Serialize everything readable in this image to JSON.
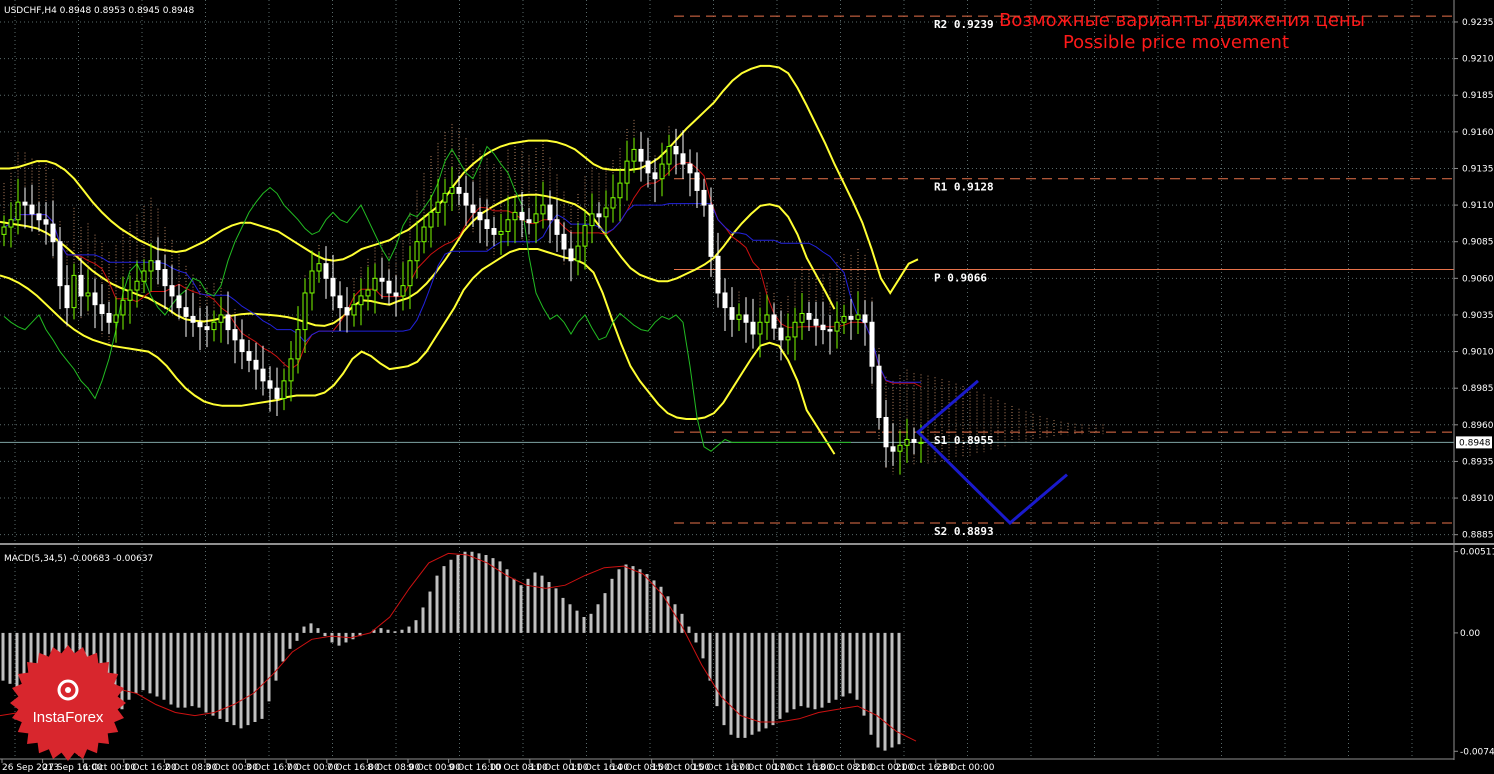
{
  "header": {
    "main": "USDCHF,H4  0.8948 0.8953 0.8945 0.8948",
    "macd": "MACD(5,34,5) -0.00683 -0.00637"
  },
  "title": {
    "line1": "Возможные варианты движения цены",
    "line2": "Possible price movement",
    "color": "#ff1a1a"
  },
  "levels": [
    {
      "name": "R2",
      "label": "R2  0.9239",
      "value": 0.9239,
      "color": "#e8724a",
      "style": "dashed"
    },
    {
      "name": "R1",
      "label": "R1  0.9128",
      "value": 0.9128,
      "color": "#e8724a",
      "style": "dashed"
    },
    {
      "name": "P",
      "label": "P  0.9066",
      "value": 0.9066,
      "color": "#e8724a",
      "style": "solid"
    },
    {
      "name": "S1",
      "label": "S1  0.8955",
      "value": 0.8955,
      "color": "#e8724a",
      "style": "dashed"
    },
    {
      "name": "S2",
      "label": "S2  0.8893",
      "value": 0.8893,
      "color": "#e8724a",
      "style": "dashed"
    }
  ],
  "current_price": {
    "label": "0.8948",
    "value": 0.8948
  },
  "price_axis": {
    "ticks": [
      "0.9235",
      "0.9210",
      "0.9185",
      "0.9160",
      "0.9135",
      "0.9110",
      "0.9085",
      "0.9060",
      "0.9035",
      "0.9010",
      "0.8985",
      "0.8960",
      "0.8935",
      "0.8910",
      "0.8885"
    ],
    "min": 0.888,
    "max": 0.925
  },
  "macd_axis": {
    "ticks": [
      "0.00511",
      "0.00",
      "-0.00744"
    ],
    "min": -0.0078,
    "max": 0.0054
  },
  "time_axis": {
    "labels": [
      "26 Sep 2013",
      "27 Sep 16:00",
      "1 Oct 00:00",
      "1 Oct 16:00",
      "2 Oct 08:00",
      "3 Oct 00:00",
      "3 Oct 16:00",
      "7 Oct 00:00",
      "7 Oct 16:00",
      "8 Oct 08:00",
      "9 Oct 00:00",
      "9 Oct 16:00",
      "10 Oct 08:00",
      "11 Oct 00:00",
      "11 Oct 16:00",
      "14 Oct 08:00",
      "15 Oct 00:00",
      "15 Oct 16:00",
      "17 Oct 00:00",
      "17 Oct 16:00",
      "18 Oct 08:00",
      "21 Oct 00:00",
      "21 Oct 16:00",
      "23 Oct 00:00"
    ]
  },
  "colors": {
    "bull_candle": "#7cfc00",
    "bear_candle": "#ffffff",
    "bollinger": "#ffff33",
    "kijun": "#cc1111",
    "tenkun": "#2222dd",
    "chikou": "#22bb22",
    "cloud": "#d69a70",
    "forecast": "#1a1acc",
    "macd_hist": "#c0c0c0",
    "macd_signal": "#cc1111",
    "grid": "#5a6a6a"
  },
  "logo": {
    "text": "InstaForex",
    "color": "#d8262d"
  },
  "chart_data": {
    "type": "candlestick",
    "symbol": "USDCHF",
    "timeframe": "H4",
    "ylim": [
      0.888,
      0.925
    ],
    "closes": [
      0.9095,
      0.91,
      0.9112,
      0.911,
      0.9104,
      0.91,
      0.9097,
      0.9085,
      0.9055,
      0.904,
      0.9062,
      0.9048,
      0.905,
      0.9042,
      0.9036,
      0.903,
      0.9035,
      0.9045,
      0.9052,
      0.9058,
      0.9065,
      0.9072,
      0.9066,
      0.9055,
      0.9048,
      0.904,
      0.9034,
      0.903,
      0.9027,
      0.9025,
      0.903,
      0.9035,
      0.9025,
      0.9018,
      0.901,
      0.9004,
      0.8998,
      0.899,
      0.8985,
      0.8978,
      0.899,
      0.9005,
      0.9025,
      0.905,
      0.9065,
      0.907,
      0.906,
      0.9048,
      0.904,
      0.9035,
      0.9042,
      0.9048,
      0.9052,
      0.906,
      0.9058,
      0.905,
      0.9048,
      0.9055,
      0.9072,
      0.9085,
      0.9095,
      0.9105,
      0.9112,
      0.9118,
      0.9122,
      0.9118,
      0.911,
      0.9105,
      0.91,
      0.9094,
      0.909,
      0.9092,
      0.91,
      0.9105,
      0.91,
      0.9098,
      0.9104,
      0.911,
      0.91,
      0.909,
      0.908,
      0.9072,
      0.9082,
      0.9096,
      0.9104,
      0.9102,
      0.9108,
      0.9115,
      0.9125,
      0.914,
      0.9148,
      0.914,
      0.9132,
      0.9128,
      0.9138,
      0.915,
      0.9145,
      0.9138,
      0.9132,
      0.912,
      0.911,
      0.9075,
      0.905,
      0.904,
      0.9032,
      0.9035,
      0.903,
      0.9022,
      0.903,
      0.9035,
      0.9026,
      0.9018,
      0.902,
      0.903,
      0.9036,
      0.9032,
      0.9028,
      0.9025,
      0.9024,
      0.903,
      0.9034,
      0.9032,
      0.9035,
      0.903,
      0.9,
      0.8965,
      0.8945,
      0.8942,
      0.8946,
      0.895,
      0.8948,
      0.8948
    ],
    "opens": [
      0.909,
      0.9095,
      0.91,
      0.9112,
      0.911,
      0.9104,
      0.91,
      0.9097,
      0.9085,
      0.9055,
      0.904,
      0.9062,
      0.9048,
      0.905,
      0.9042,
      0.9036,
      0.903,
      0.9035,
      0.9045,
      0.9052,
      0.9058,
      0.9065,
      0.9072,
      0.9066,
      0.9055,
      0.9048,
      0.904,
      0.9034,
      0.903,
      0.9027,
      0.9025,
      0.903,
      0.9035,
      0.9025,
      0.9018,
      0.901,
      0.9004,
      0.8998,
      0.899,
      0.8985,
      0.8978,
      0.899,
      0.9005,
      0.9025,
      0.905,
      0.9065,
      0.907,
      0.906,
      0.9048,
      0.904,
      0.9035,
      0.9042,
      0.9048,
      0.9052,
      0.906,
      0.9058,
      0.905,
      0.9048,
      0.9055,
      0.9072,
      0.9085,
      0.9095,
      0.9105,
      0.9112,
      0.9118,
      0.9122,
      0.9118,
      0.911,
      0.9105,
      0.91,
      0.9094,
      0.909,
      0.9092,
      0.91,
      0.9105,
      0.91,
      0.9098,
      0.9104,
      0.911,
      0.91,
      0.909,
      0.908,
      0.9072,
      0.9082,
      0.9096,
      0.9104,
      0.9102,
      0.9108,
      0.9115,
      0.9125,
      0.914,
      0.9148,
      0.914,
      0.9132,
      0.9128,
      0.9138,
      0.915,
      0.9145,
      0.9138,
      0.9132,
      0.912,
      0.911,
      0.9075,
      0.905,
      0.904,
      0.9032,
      0.9035,
      0.903,
      0.9022,
      0.903,
      0.9035,
      0.9026,
      0.9018,
      0.902,
      0.903,
      0.9036,
      0.9032,
      0.9028,
      0.9025,
      0.9024,
      0.903,
      0.9034,
      0.9032,
      0.9035,
      0.903,
      0.9,
      0.8965,
      0.8945,
      0.8942,
      0.8946,
      0.895,
      0.8948
    ],
    "bollinger_upper": [
      0.9135,
      0.9135,
      0.9136,
      0.9138,
      0.914,
      0.914,
      0.9138,
      0.9134,
      0.9128,
      0.912,
      0.9112,
      0.9105,
      0.9099,
      0.9094,
      0.909,
      0.9086,
      0.9083,
      0.908,
      0.9079,
      0.9078,
      0.9079,
      0.9082,
      0.9085,
      0.9089,
      0.9093,
      0.9096,
      0.9098,
      0.9098,
      0.9096,
      0.9094,
      0.9092,
      0.9088,
      0.9084,
      0.908,
      0.9076,
      0.9073,
      0.9072,
      0.9073,
      0.9076,
      0.908,
      0.9082,
      0.9084,
      0.9086,
      0.909,
      0.9093,
      0.9098,
      0.9103,
      0.9108,
      0.9115,
      0.9124,
      0.9132,
      0.9138,
      0.9143,
      0.9147,
      0.915,
      0.9152,
      0.9153,
      0.9154,
      0.9154,
      0.9154,
      0.9153,
      0.9151,
      0.9148,
      0.9143,
      0.9138,
      0.9135,
      0.9134,
      0.9134,
      0.9134,
      0.9135,
      0.9138,
      0.9142,
      0.9148,
      0.9155,
      0.9162,
      0.9168,
      0.9174,
      0.918,
      0.9188,
      0.9195,
      0.92,
      0.9203,
      0.9205,
      0.9205,
      0.9204,
      0.92,
      0.919,
      0.9178,
      0.9165,
      0.9152,
      0.9138,
      0.9125,
      0.9112,
      0.9098,
      0.908,
      0.906,
      0.905,
      0.906,
      0.907,
      0.9073
    ],
    "bollinger_lower": [
      0.9062,
      0.906,
      0.9057,
      0.9053,
      0.9048,
      0.9042,
      0.9036,
      0.903,
      0.9025,
      0.9021,
      0.9018,
      0.9016,
      0.9014,
      0.9013,
      0.9012,
      0.9011,
      0.901,
      0.9006,
      0.9,
      0.8992,
      0.8985,
      0.898,
      0.8976,
      0.8974,
      0.8973,
      0.8973,
      0.8973,
      0.8974,
      0.8975,
      0.8976,
      0.8977,
      0.8979,
      0.898,
      0.898,
      0.898,
      0.8982,
      0.8987,
      0.8995,
      0.9005,
      0.901,
      0.9007,
      0.9002,
      0.8998,
      0.8999,
      0.9,
      0.9003,
      0.901,
      0.902,
      0.903,
      0.904,
      0.9052,
      0.906,
      0.9066,
      0.907,
      0.9074,
      0.9078,
      0.908,
      0.908,
      0.908,
      0.9078,
      0.9076,
      0.9074,
      0.9073,
      0.907,
      0.9064,
      0.905,
      0.9032,
      0.9015,
      0.9,
      0.899,
      0.8982,
      0.8974,
      0.8968,
      0.8965,
      0.8964,
      0.8964,
      0.8965,
      0.8968,
      0.8975,
      0.8985,
      0.8995,
      0.9005,
      0.9014,
      0.9016,
      0.9014,
      0.9004,
      0.899,
      0.897,
      0.896,
      0.895,
      0.894
    ],
    "forecast_path": [
      {
        "t": 0,
        "price": 0.8955
      },
      {
        "t": 1,
        "price": 0.899
      },
      {
        "t": 0,
        "price": 0.8955
      },
      {
        "t": 2,
        "price": 0.8893
      },
      {
        "t": 3,
        "price": 0.8926
      }
    ],
    "macd_histogram": [
      -0.003,
      -0.0032,
      -0.0034,
      -0.0038,
      -0.0042,
      -0.0046,
      -0.0048,
      -0.005,
      -0.0052,
      -0.0056,
      -0.006,
      -0.0062,
      -0.006,
      -0.0058,
      -0.0056,
      -0.0055,
      -0.0052,
      -0.0048,
      -0.0042,
      -0.0038,
      -0.0036,
      -0.0038,
      -0.004,
      -0.0042,
      -0.0045,
      -0.0047,
      -0.0047,
      -0.0046,
      -0.0047,
      -0.005,
      -0.0052,
      -0.0054,
      -0.0056,
      -0.0058,
      -0.006,
      -0.0058,
      -0.0056,
      -0.0054,
      -0.0043,
      -0.003,
      -0.0018,
      -0.001,
      -0.0005,
      0.0004,
      0.0006,
      0.0003,
      -0.0002,
      -0.0006,
      -0.0008,
      -0.0006,
      -0.0004,
      -0.0002,
      0.0,
      0.0002,
      0.0003,
      0.0002,
      0.0001,
      0.0002,
      0.0004,
      0.0008,
      0.0016,
      0.0026,
      0.0036,
      0.0042,
      0.0046,
      0.0049,
      0.0051,
      0.0051,
      0.005,
      0.0049,
      0.0047,
      0.0045,
      0.004,
      0.0034,
      0.003,
      0.0034,
      0.0038,
      0.0036,
      0.0032,
      0.0028,
      0.0022,
      0.0018,
      0.0014,
      0.001,
      0.0012,
      0.0018,
      0.0025,
      0.0034,
      0.004,
      0.0043,
      0.0042,
      0.004,
      0.0037,
      0.0033,
      0.0029,
      0.0023,
      0.0018,
      0.0012,
      0.0004,
      -0.0006,
      -0.0016,
      -0.003,
      -0.0046,
      -0.0058,
      -0.0064,
      -0.0066,
      -0.0066,
      -0.0064,
      -0.0062,
      -0.006,
      -0.0058,
      -0.0054,
      -0.005,
      -0.0048,
      -0.0046,
      -0.0047,
      -0.0048,
      -0.0047,
      -0.0044,
      -0.0042,
      -0.004,
      -0.0038,
      -0.0042,
      -0.0052,
      -0.0064,
      -0.0072,
      -0.0074,
      -0.0072,
      -0.007
    ],
    "macd_signal_line": [
      -0.0052,
      -0.005,
      -0.0048,
      -0.0048,
      -0.0048,
      -0.004,
      -0.0035,
      -0.0038,
      -0.0045,
      -0.005,
      -0.0052,
      -0.005,
      -0.0045,
      -0.0038,
      -0.0026,
      -0.0012,
      -0.0004,
      -0.0002,
      -0.0003,
      0.0,
      0.001,
      0.0028,
      0.0044,
      0.005,
      0.0049,
      0.0044,
      0.0036,
      0.003,
      0.0028,
      0.003,
      0.0036,
      0.0041,
      0.0042,
      0.0037,
      0.0024,
      0.0004,
      -0.002,
      -0.004,
      -0.0052,
      -0.0056,
      -0.0056,
      -0.0054,
      -0.005,
      -0.0048,
      -0.0046,
      -0.0052,
      -0.0062,
      -0.0068
    ]
  }
}
